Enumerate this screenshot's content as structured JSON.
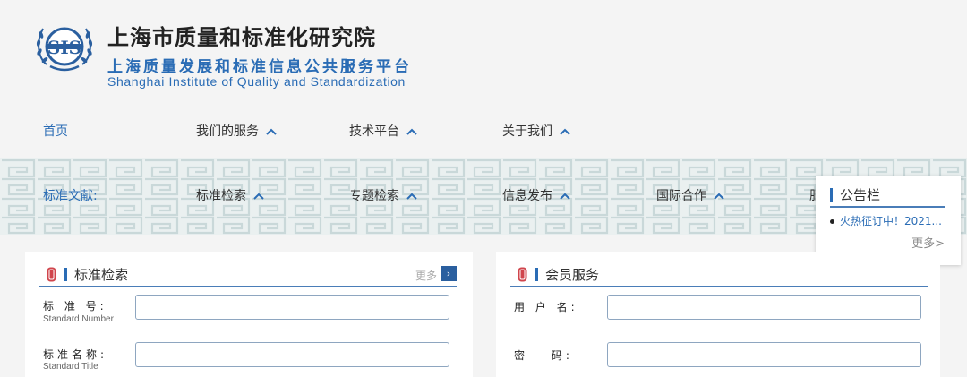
{
  "header": {
    "title_cn": "上海市质量和标准化研究院",
    "subtitle_cn": "上海质量发展和标准信息公共服务平台",
    "subtitle_en": "Shanghai Institute of Quality and Standardization",
    "logo_text": "SIS"
  },
  "nav": {
    "primary": [
      {
        "label": "首页",
        "has_menu": false
      },
      {
        "label": "我们的服务",
        "has_menu": true
      },
      {
        "label": "技术平台",
        "has_menu": true
      },
      {
        "label": "关于我们",
        "has_menu": true
      }
    ],
    "secondary_label": "标准文献:",
    "secondary": [
      {
        "label": "标准检索",
        "has_menu": true
      },
      {
        "label": "专题检索",
        "has_menu": true
      },
      {
        "label": "信息发布",
        "has_menu": true
      },
      {
        "label": "国际合作",
        "has_menu": true
      },
      {
        "label": "服",
        "has_menu": false
      }
    ]
  },
  "notice": {
    "title": "公告栏",
    "item": "火热征订中！2021...",
    "more": "更多>"
  },
  "standard_search": {
    "title": "标准检索",
    "more": "更多",
    "more_btn": "›",
    "number_label": "标 准 号:",
    "number_sub": "Standard Number",
    "name_label": "标准名称:",
    "name_sub": "Standard Title"
  },
  "member": {
    "title": "会员服务",
    "user_label": "用 户 名:",
    "password_label": "密 码:"
  },
  "colors": {
    "accent": "#2a6cb5",
    "band_bg": "#eaf0f0",
    "pattern": "#c9d8d9",
    "seal": "#d0454c"
  }
}
